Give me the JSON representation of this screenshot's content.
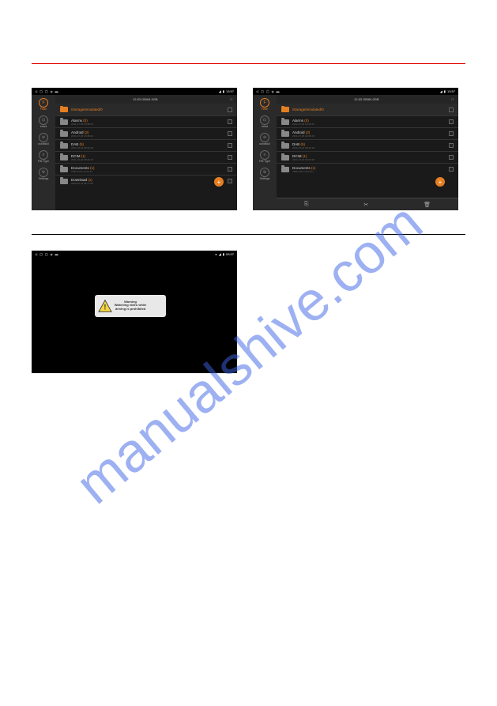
{
  "watermark": "manualshive.com",
  "status": {
    "time1": "13:57",
    "time2": "09:07",
    "storage": "12.83 GB/64.0GB"
  },
  "sidebar": {
    "items": [
      {
        "label": "Flash",
        "icon": "F"
      },
      {
        "label": "extsd",
        "icon": "⊡"
      },
      {
        "label": "usbdisk0",
        "icon": "⊘"
      },
      {
        "label": "File Type",
        "icon": "≡"
      },
      {
        "label": "Settings",
        "icon": "⚙"
      }
    ]
  },
  "fm": {
    "path": "/storage/emulated/0",
    "rows": [
      {
        "name": "Alarms",
        "count": "(0)",
        "date": "2021-07-06 10:48:43"
      },
      {
        "name": "Android",
        "count": "(3)",
        "date": "2021-07-06 10:48:43"
      },
      {
        "name": "DAB",
        "count": "(5)",
        "date": "2021-10-24 08:40:18"
      },
      {
        "name": "DCIM",
        "count": "(1)",
        "date": "2021-10-24 08:40:18"
      },
      {
        "name": "Documents",
        "count": "(1)",
        "date": "7586 2021-13:24:41"
      },
      {
        "name": "Download",
        "count": "(1)",
        "date": "2020-01 12:48:17:08"
      }
    ]
  },
  "warning": {
    "title": "Warning",
    "line1": "Watching video while",
    "line2": "driving is prohibited"
  }
}
